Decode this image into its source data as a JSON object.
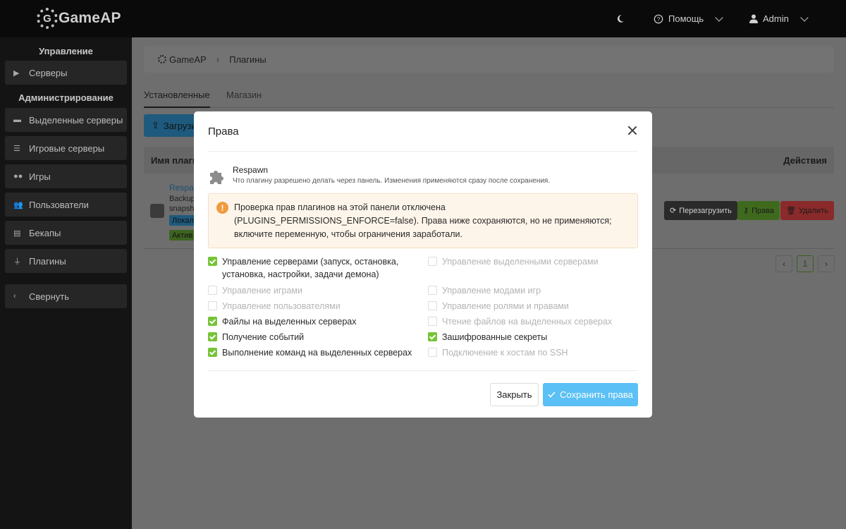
{
  "app": {
    "logo_text": "GameAP",
    "logo_glyph": "G"
  },
  "topbar": {
    "theme_icon": "moon-icon",
    "help_label": "Помощь",
    "user_label": "Admin"
  },
  "sidebar": {
    "section_manage": "Управление",
    "section_admin": "Администрирование",
    "items": [
      {
        "label": "Серверы",
        "icon": "play-icon"
      },
      {
        "label": "Выделенные серверы",
        "icon": "server-icon"
      },
      {
        "label": "Игровые серверы",
        "icon": "server-stack-icon"
      },
      {
        "label": "Игры",
        "icon": "gamepad-icon"
      },
      {
        "label": "Пользователи",
        "icon": "users-icon"
      },
      {
        "label": "Бекапы",
        "icon": "backup-icon"
      },
      {
        "label": "Плагины",
        "icon": "plug-icon"
      },
      {
        "label": "Свернуть",
        "icon": "chevron-left-icon"
      }
    ]
  },
  "breadcrumb": {
    "home": "GameAP",
    "current": "Плагины"
  },
  "tabs": {
    "installed": "Установленные",
    "store": "Магазин"
  },
  "background": {
    "upload_label": "Загрузи",
    "col_name": "Имя плагин",
    "col_actions": "Действия",
    "row_name": "Respaw",
    "row_line1": "Backup",
    "row_line2": "snapsh",
    "tag_local": "Локал",
    "tag_active": "Актив",
    "btn_restart": "Перезагрузить",
    "btn_rights": "Права",
    "btn_delete": "Удалить",
    "page_current": "1",
    "page_prev": "‹",
    "page_next": "›"
  },
  "modal": {
    "title": "Права",
    "plugin_name": "Respawn",
    "plugin_desc": "Что плагину разрешено делать через панель. Изменения применяются сразу после сохранения.",
    "warning_icon": "!",
    "warning_text": "Проверка прав плагинов на этой панели отключена (PLUGINS_PERMISSIONS_ENFORCE=false). Права ниже сохраняются, но не применяются; включите переменную, чтобы ограничения заработали.",
    "permissions_left": [
      {
        "label": "Управление серверами (запуск, остановка, установка, настройки, задачи демона)",
        "checked": true
      },
      {
        "label": "Управление играми",
        "checked": false
      },
      {
        "label": "Управление пользователями",
        "checked": false
      },
      {
        "label": "Файлы на выделенных серверах",
        "checked": true
      },
      {
        "label": "Получение событий",
        "checked": true
      },
      {
        "label": "Выполнение команд на выделенных серверах",
        "checked": true
      }
    ],
    "permissions_right": [
      {
        "label": "Управление выделенными серверами",
        "checked": false
      },
      {
        "label": "Управление модами игр",
        "checked": false
      },
      {
        "label": "Управление ролями и правами",
        "checked": false
      },
      {
        "label": "Чтение файлов на выделенных серверах",
        "checked": false
      },
      {
        "label": "Зашифрованные секреты",
        "checked": true
      },
      {
        "label": "Подключение к хостам по SSH",
        "checked": false
      }
    ],
    "close_label": "Закрыть",
    "save_label": "Сохранить права"
  },
  "colors": {
    "accent_green": "#76c436",
    "save_blue": "#5bc0f5",
    "warning_orange": "#f19a3e"
  }
}
